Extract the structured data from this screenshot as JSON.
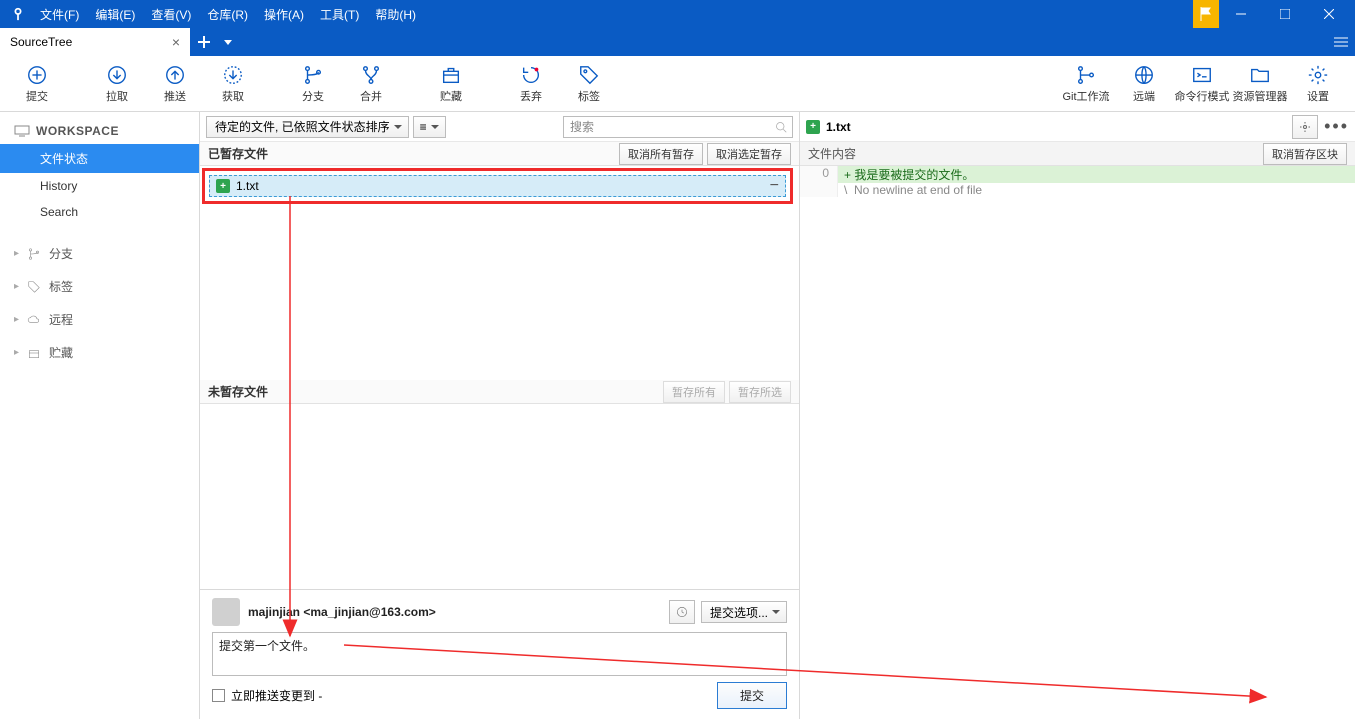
{
  "menu": {
    "file": "文件(F)",
    "edit": "编辑(E)",
    "view": "查看(V)",
    "repo": "仓库(R)",
    "action": "操作(A)",
    "tools": "工具(T)",
    "help": "帮助(H)"
  },
  "tab": {
    "name": "SourceTree"
  },
  "toolbar": {
    "commit": "提交",
    "pull": "拉取",
    "push": "推送",
    "fetch": "获取",
    "branch": "分支",
    "merge": "合并",
    "stash": "贮藏",
    "discard": "丢弃",
    "tag": "标签",
    "gitflow": "Git工作流",
    "remote": "远端",
    "terminal": "命令行模式",
    "explorer": "资源管理器",
    "settings": "设置"
  },
  "sidebar": {
    "workspace": "WORKSPACE",
    "fileStatus": "文件状态",
    "history": "History",
    "search": "Search",
    "branches": "分支",
    "tags": "标签",
    "remotes": "远程",
    "stashes": "贮藏"
  },
  "filter": {
    "combo": "待定的文件, 已依照文件状态排序",
    "viewMode": "≡"
  },
  "search": {
    "placeholder": "搜索"
  },
  "staged": {
    "header": "已暂存文件",
    "unstageAll": "取消所有暂存",
    "unstageSel": "取消选定暂存",
    "file": "1.txt"
  },
  "unstaged": {
    "header": "未暂存文件",
    "stageAll": "暂存所有",
    "stageSel": "暂存所选"
  },
  "diff": {
    "file": "1.txt",
    "contentHeader": "文件内容",
    "discardHunk": "取消暂存区块",
    "gutter": "0",
    "line1": "+ 我是要被提交的文件。",
    "line2": "\\  No newline at end of file"
  },
  "commit": {
    "user": "majinjian <ma_jinjian@163.com>",
    "optionsBtn": "提交选项...",
    "message": "提交第一个文件。",
    "pushCheck": "立即推送变更到  -",
    "submit": "提交"
  }
}
